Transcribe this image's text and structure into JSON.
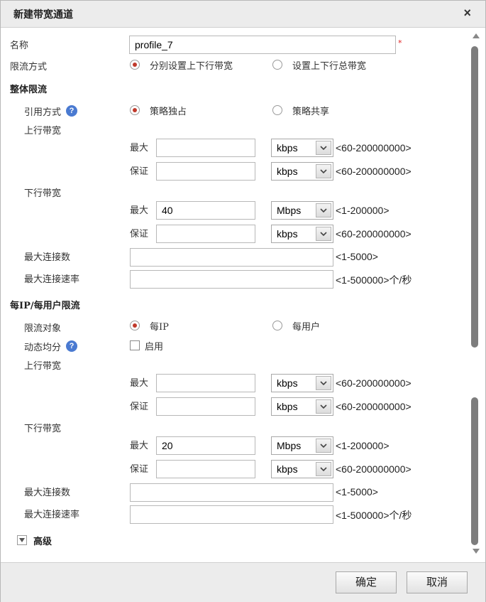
{
  "dialog": {
    "title": "新建带宽通道",
    "close": "×"
  },
  "form": {
    "name_label": "名称",
    "name_value": "profile_7",
    "required_mark": "*",
    "limit_mode_label": "限流方式",
    "limit_mode_options": [
      "分别设置上下行带宽",
      "设置上下行总带宽"
    ],
    "overall_section": "整体限流",
    "ref_mode_label": "引用方式",
    "ref_mode_options": [
      "策略独占",
      "策略共享"
    ],
    "uplink_label": "上行带宽",
    "downlink_label": "下行带宽",
    "max_label": "最大",
    "guarantee_label": "保证",
    "max_conn_label": "最大连接数",
    "max_conn_rate_label": "最大连接速率",
    "per_section": "每IP/每用户限流",
    "limit_target_label": "限流对象",
    "limit_target_options": [
      "每IP",
      "每用户"
    ],
    "dynamic_label": "动态均分",
    "enable_label": "启用",
    "advanced_label": "高级",
    "help": "?"
  },
  "overall": {
    "up_max": {
      "value": "",
      "unit": "kbps",
      "range": "<60-200000000>"
    },
    "up_guarantee": {
      "value": "",
      "unit": "kbps",
      "range": "<60-200000000>"
    },
    "down_max": {
      "value": "40",
      "unit": "Mbps",
      "range": "<1-200000>"
    },
    "down_guarantee": {
      "value": "",
      "unit": "kbps",
      "range": "<60-200000000>"
    },
    "max_conn": {
      "value": "",
      "range": "<1-5000>"
    },
    "max_conn_rate": {
      "value": "",
      "range": "<1-500000>个/秒"
    }
  },
  "per": {
    "up_max": {
      "value": "",
      "unit": "kbps",
      "range": "<60-200000000>"
    },
    "up_guarantee": {
      "value": "",
      "unit": "kbps",
      "range": "<60-200000000>"
    },
    "down_max": {
      "value": "20",
      "unit": "Mbps",
      "range": "<1-200000>"
    },
    "down_guarantee": {
      "value": "",
      "unit": "kbps",
      "range": "<60-200000000>"
    },
    "max_conn": {
      "value": "",
      "range": "<1-5000>"
    },
    "max_conn_rate": {
      "value": "",
      "range": "<1-500000>个/秒"
    }
  },
  "footer": {
    "ok": "确定",
    "cancel": "取消"
  },
  "colors": {
    "radio_selected": "#c0392b",
    "help_icon": "#4a7ad1",
    "required": "#e02020"
  }
}
